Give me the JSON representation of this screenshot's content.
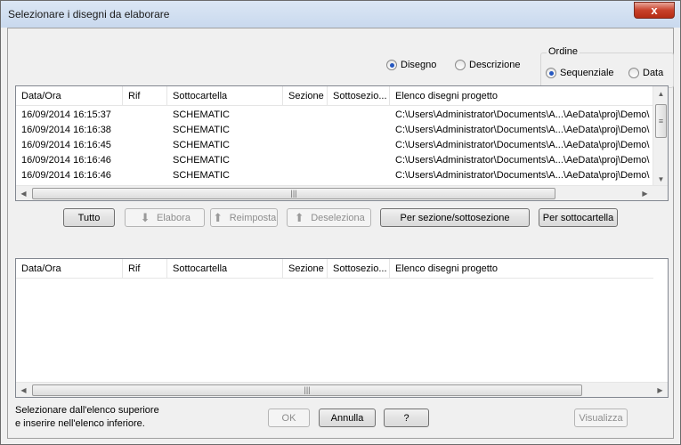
{
  "window": {
    "title": "Selezionare i disegni da elaborare",
    "close_symbol": "x"
  },
  "view_mode": {
    "options": [
      {
        "label": "Disegno",
        "selected": true
      },
      {
        "label": "Descrizione",
        "selected": false
      }
    ]
  },
  "ordine": {
    "label": "Ordine",
    "options": [
      {
        "label": "Sequenziale",
        "selected": true
      },
      {
        "label": "Data",
        "selected": false
      }
    ]
  },
  "columns": [
    "Data/Ora",
    "Rif",
    "Sottocartella",
    "Sezione",
    "Sottosezio...",
    "Elenco disegni progetto"
  ],
  "upper_list": {
    "rows": [
      [
        "16/09/2014 16:15:37",
        "",
        "SCHEMATIC",
        "",
        "",
        "C:\\Users\\Administrator\\Documents\\A...\\AeData\\proj\\Demo\\"
      ],
      [
        "16/09/2014 16:16:38",
        "",
        "SCHEMATIC",
        "",
        "",
        "C:\\Users\\Administrator\\Documents\\A...\\AeData\\proj\\Demo\\"
      ],
      [
        "16/09/2014 16:16:45",
        "",
        "SCHEMATIC",
        "",
        "",
        "C:\\Users\\Administrator\\Documents\\A...\\AeData\\proj\\Demo\\"
      ],
      [
        "16/09/2014 16:16:46",
        "",
        "SCHEMATIC",
        "",
        "",
        "C:\\Users\\Administrator\\Documents\\A...\\AeData\\proj\\Demo\\"
      ],
      [
        "16/09/2014 16:16:46",
        "",
        "SCHEMATIC",
        "",
        "",
        "C:\\Users\\Administrator\\Documents\\A...\\AeData\\proj\\Demo\\"
      ]
    ]
  },
  "lower_list": {
    "rows": []
  },
  "middle_buttons": {
    "tutto": "Tutto",
    "elabora": "Elabora",
    "reimposta": "Reimposta",
    "deseleziona": "Deseleziona",
    "per_sezione": "Per sezione/sottosezione",
    "per_sottocartella": "Per sottocartella"
  },
  "footer": {
    "info_line1": "Selezionare dall'elenco superiore",
    "info_line2": "e inserire nell'elenco inferiore.",
    "ok": "OK",
    "annulla": "Annulla",
    "help": "?",
    "visualizza": "Visualizza"
  },
  "scroll_symbols": {
    "left": "◀",
    "right": "▶",
    "up": "▲",
    "down": "▼",
    "grip": "|||"
  },
  "icons": {
    "down_arrow": "arrow-down-icon",
    "up_arrow": "arrow-up-icon"
  }
}
